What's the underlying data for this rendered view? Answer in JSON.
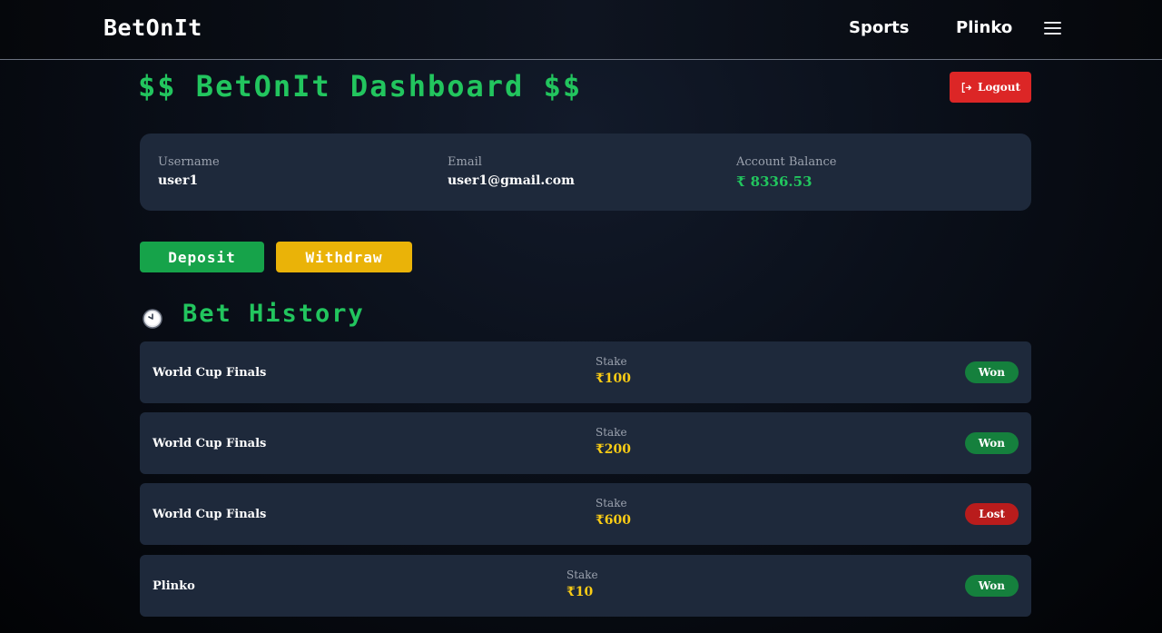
{
  "header": {
    "brand": "BetOnIt",
    "nav": [
      "Sports",
      "Plinko"
    ]
  },
  "dashboard": {
    "title": "$$ BetOnIt Dashboard $$",
    "logout_label": "Logout"
  },
  "account": {
    "username_label": "Username",
    "username": "user1",
    "email_label": "Email",
    "email": "user1@gmail.com",
    "balance_label": "Account Balance",
    "balance": "₹ 8336.53"
  },
  "actions": {
    "deposit_label": "Deposit",
    "withdraw_label": "Withdraw"
  },
  "history": {
    "title": "Bet History",
    "stake_label": "Stake",
    "bets": [
      {
        "name": "World Cup Finals",
        "stake": "₹100",
        "status": "Won"
      },
      {
        "name": "World Cup Finals",
        "stake": "₹200",
        "status": "Won"
      },
      {
        "name": "World Cup Finals",
        "stake": "₹600",
        "status": "Lost"
      },
      {
        "name": "Plinko",
        "stake": "₹10",
        "status": "Won"
      }
    ]
  },
  "colors": {
    "accent_green": "#22c55e",
    "logout_red": "#dc2626",
    "withdraw_yellow": "#eab308",
    "won_badge": "#15803d",
    "lost_badge": "#b91c1c"
  },
  "icons": {
    "menu": "hamburger-menu-icon",
    "logout": "logout-icon",
    "history": "clock-icon"
  }
}
